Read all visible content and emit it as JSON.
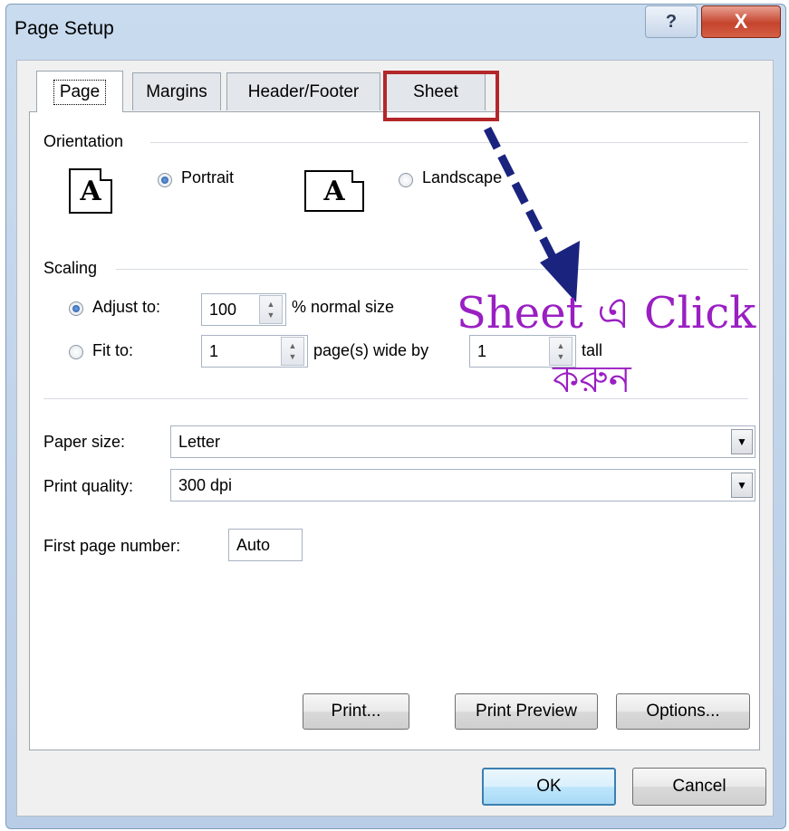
{
  "window": {
    "title": "Page Setup",
    "help_label": "?",
    "close_label": "X"
  },
  "tabs": [
    {
      "label": "Page",
      "active": true
    },
    {
      "label": "Margins",
      "active": false
    },
    {
      "label": "Header/Footer",
      "active": false
    },
    {
      "label": "Sheet",
      "active": false
    }
  ],
  "orientation": {
    "section_label": "Orientation",
    "icon_glyph": "A",
    "portrait_label": "Portrait",
    "landscape_label": "Landscape",
    "selected": "portrait"
  },
  "scaling": {
    "section_label": "Scaling",
    "adjust_to_label": "Adjust to:",
    "adjust_value": "100",
    "normal_size_label": "% normal size",
    "fit_to_label": "Fit to:",
    "pages_wide_value": "1",
    "pages_wide_label": "page(s) wide by",
    "tall_value": "1",
    "tall_label": "tall",
    "selected": "adjust"
  },
  "paper_size": {
    "label": "Paper size:",
    "value": "Letter"
  },
  "print_quality": {
    "label": "Print quality:",
    "value": "300 dpi"
  },
  "first_page_number": {
    "label": "First page number:",
    "value": "Auto"
  },
  "buttons": {
    "print": "Print...",
    "print_preview": "Print Preview",
    "options": "Options...",
    "ok": "OK",
    "cancel": "Cancel"
  },
  "annotation": {
    "line1": "Sheet এ Click",
    "line2": "করুন",
    "color": "#9a1fc2",
    "arrow_color": "#1a237e",
    "highlight_color": "#b3272a"
  }
}
